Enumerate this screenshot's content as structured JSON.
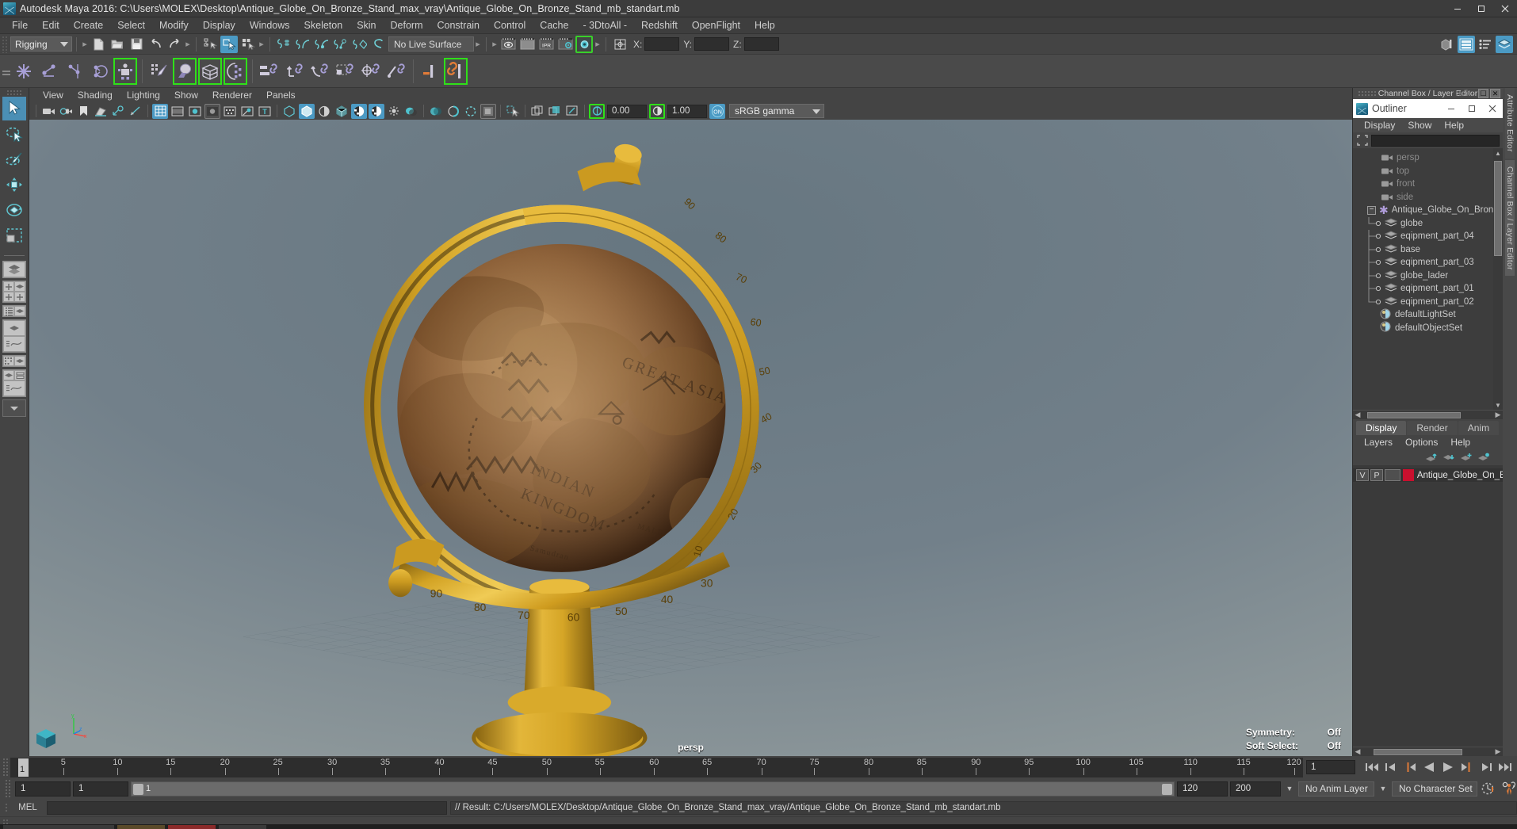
{
  "window": {
    "title": "Autodesk Maya 2016: C:\\Users\\MOLEX\\Desktop\\Antique_Globe_On_Bronze_Stand_max_vray\\Antique_Globe_On_Bronze_Stand_mb_standart.mb",
    "minimize": "minimize-button",
    "maximize": "maximize-button",
    "close": "close-button"
  },
  "menubar": {
    "items": [
      "File",
      "Edit",
      "Create",
      "Select",
      "Modify",
      "Display",
      "Windows",
      "Skeleton",
      "Skin",
      "Deform",
      "Constrain",
      "Control",
      "Cache",
      "- 3DtoAll -",
      "Redshift",
      "OpenFlight",
      "Help"
    ]
  },
  "statusline": {
    "menu_set": "Rigging",
    "live_surface": "No Live Surface",
    "coord_labels": [
      "X:",
      "Y:",
      "Z:"
    ],
    "coord_values": [
      "",
      "",
      ""
    ]
  },
  "viewport_menu": {
    "items": [
      "View",
      "Shading",
      "Lighting",
      "Show",
      "Renderer",
      "Panels"
    ]
  },
  "viewport_toolbar": {
    "exposure": "0.00",
    "gamma": "1.00",
    "color_profile": "sRGB gamma"
  },
  "viewport": {
    "camera_label": "persp",
    "stats": [
      {
        "label": "Symmetry:",
        "value": "Off"
      },
      {
        "label": "Soft Select:",
        "value": "Off"
      }
    ],
    "axes": [
      "y",
      "x",
      "z"
    ]
  },
  "channel_box_header": {
    "title": "Channel Box / Layer Editor"
  },
  "outliner": {
    "title": "Outliner",
    "menus": [
      "Display",
      "Show",
      "Help"
    ],
    "search_value": "",
    "search_placeholder": "",
    "cameras": [
      "persp",
      "top",
      "front",
      "side"
    ],
    "group": {
      "name": "Antique_Globe_On_Bronze",
      "expander": "−",
      "children": [
        "globe",
        "eqipment_part_04",
        "base",
        "eqipment_part_03",
        "globe_lader",
        "eqipment_part_01",
        "eqipment_part_02"
      ]
    },
    "sets": [
      "defaultLightSet",
      "defaultObjectSet"
    ]
  },
  "layer_editor": {
    "tabs": [
      "Display",
      "Render",
      "Anim"
    ],
    "active_tab": "Display",
    "menus": [
      "Layers",
      "Options",
      "Help"
    ],
    "layers": [
      {
        "visibility": "V",
        "playback": "P",
        "color": "#c8102e",
        "name": "Antique_Globe_On_Br"
      }
    ]
  },
  "side_tabs": [
    "Attribute Editor",
    "Channel Box / Layer Editor"
  ],
  "timeline": {
    "ticks": [
      5,
      10,
      15,
      20,
      25,
      30,
      35,
      40,
      45,
      50,
      55,
      60,
      65,
      70,
      75,
      80,
      85,
      90,
      95,
      100,
      105,
      110,
      115,
      120
    ],
    "range_start": 1,
    "range_end": 120,
    "current_frame": "1",
    "current_frame_marker": "1"
  },
  "range": {
    "start_field": "1",
    "end_field": "1",
    "slider_label": "1",
    "playback_end": "120",
    "range_end": "200",
    "anim_layer": "No Anim Layer",
    "character_set": "No Character Set"
  },
  "command_line": {
    "label": "MEL",
    "input_value": "",
    "result": "// Result: C:/Users/MOLEX/Desktop/Antique_Globe_On_Bronze_Stand_max_vray/Antique_Globe_On_Bronze_Stand_mb_standart.mb"
  }
}
